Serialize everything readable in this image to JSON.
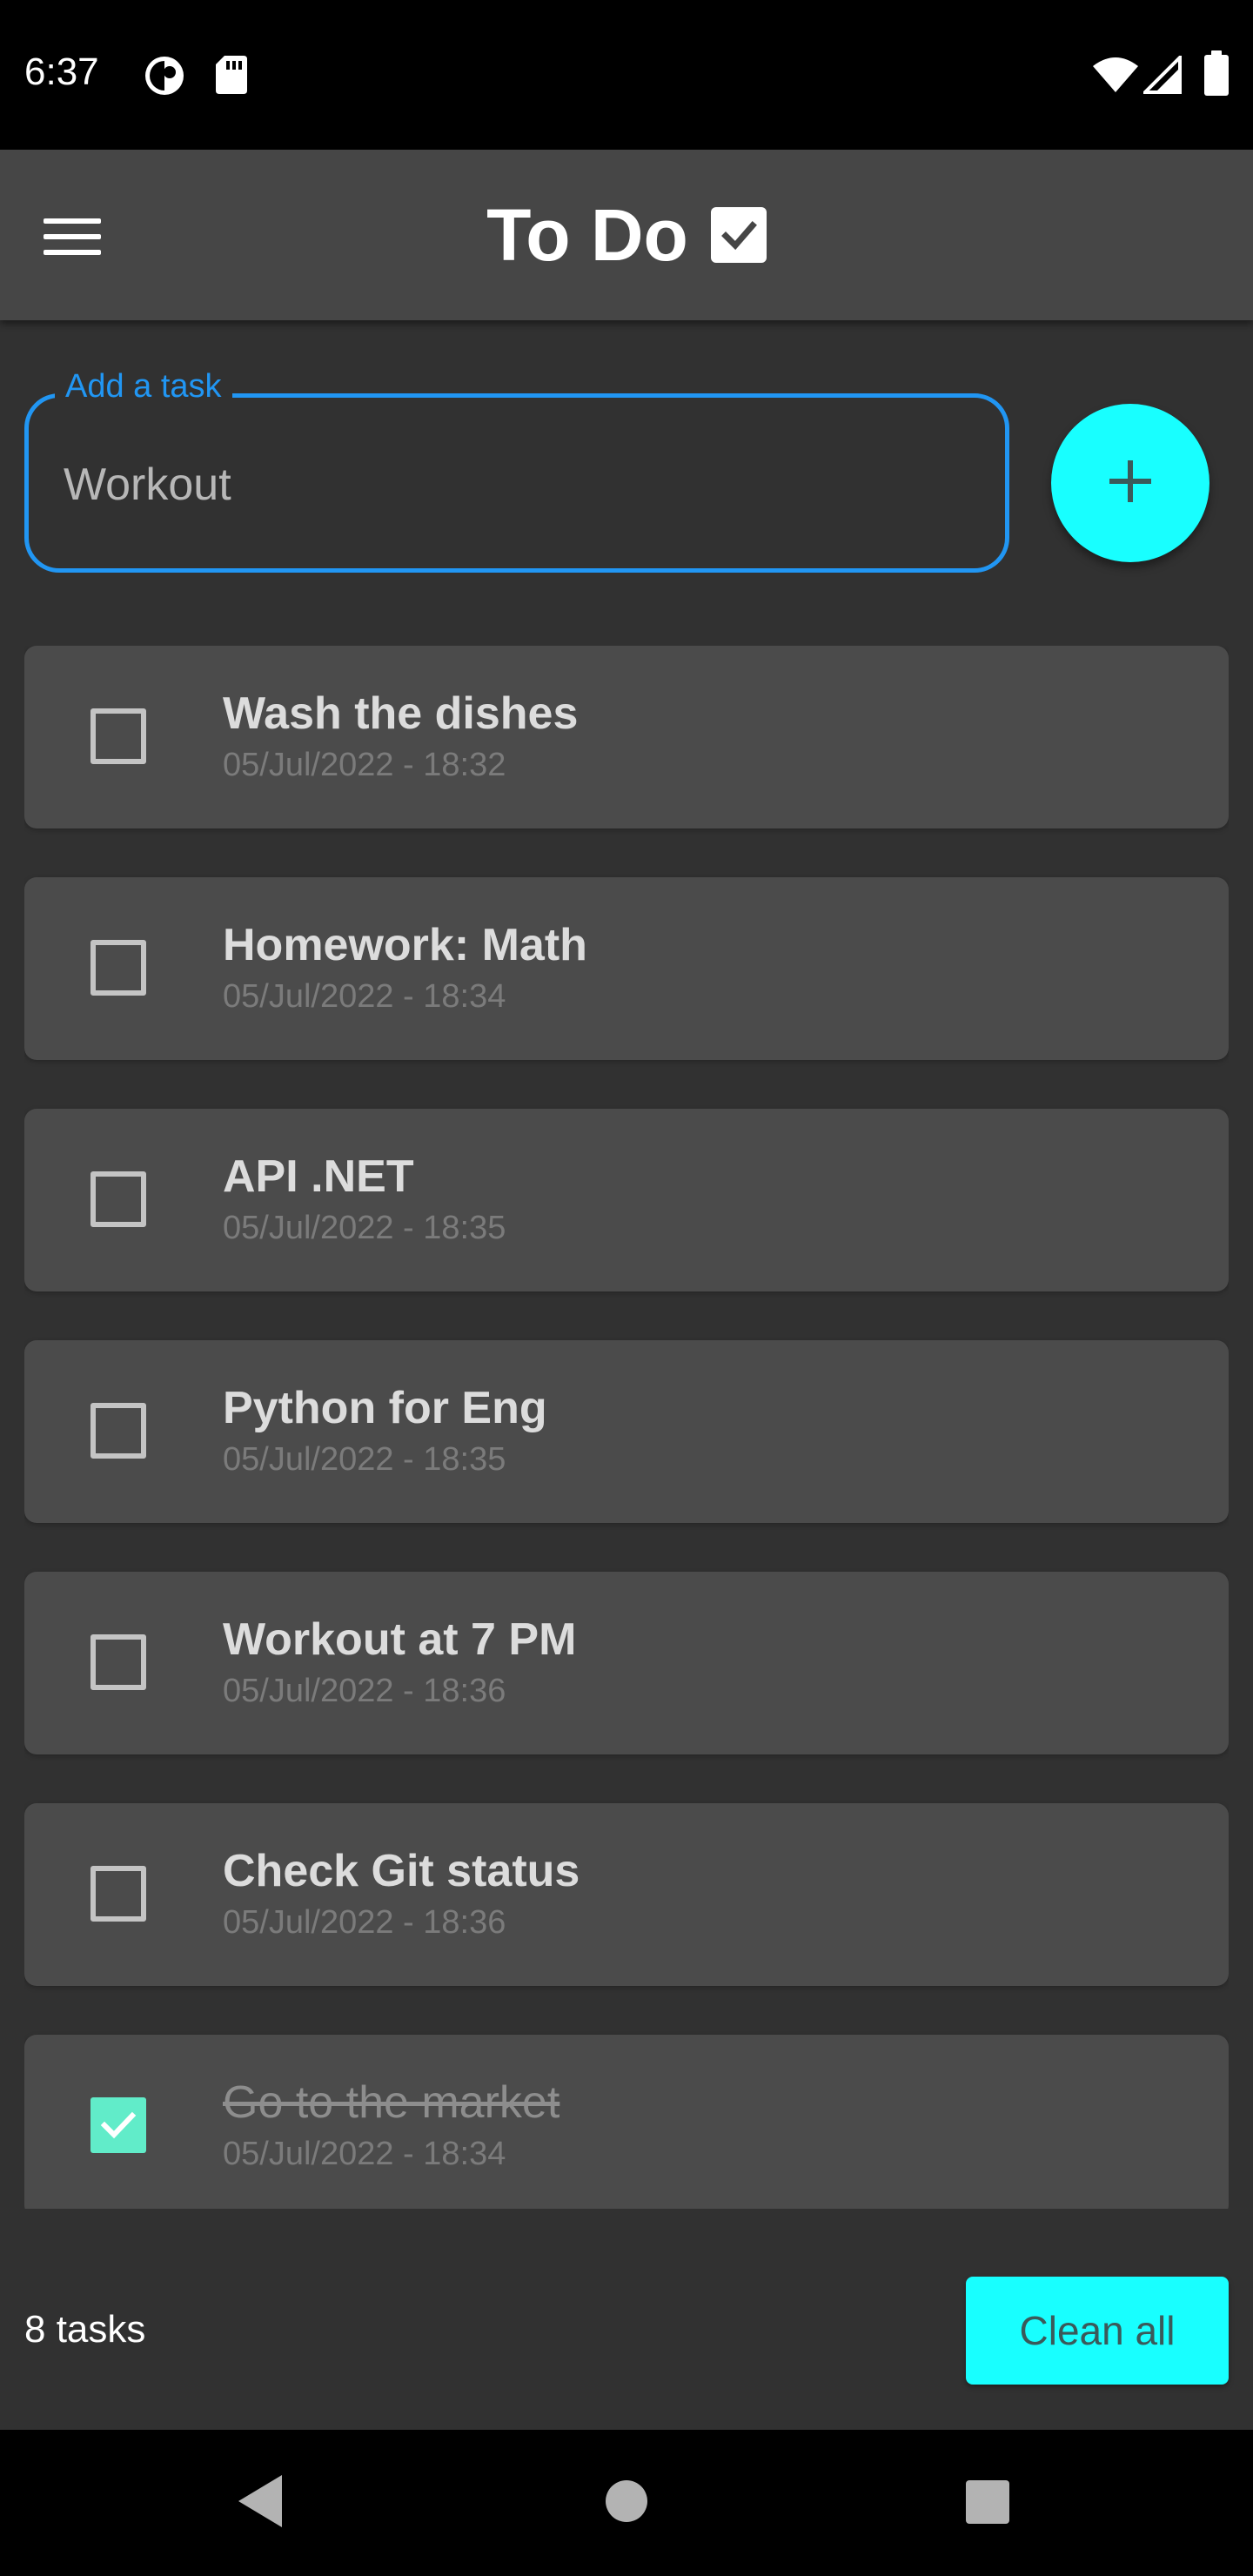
{
  "status_bar": {
    "time": "6:37",
    "left_icons": [
      "data-saver-icon",
      "sd-card-icon"
    ],
    "right_icons": [
      "wifi-icon",
      "cell-signal-icon",
      "battery-icon"
    ]
  },
  "app_bar": {
    "menu_icon": "menu-icon",
    "title": "To Do",
    "title_icon": "checkbox-checked-icon"
  },
  "add_task": {
    "label": "Add a task",
    "value": "Workout",
    "button_icon": "plus-icon"
  },
  "tasks": [
    {
      "title": "Wash the dishes",
      "timestamp": "05/Jul/2022 - 18:32",
      "done": false
    },
    {
      "title": "Homework: Math",
      "timestamp": "05/Jul/2022 - 18:34",
      "done": false
    },
    {
      "title": "API .NET",
      "timestamp": "05/Jul/2022 - 18:35",
      "done": false
    },
    {
      "title": "Python for Eng",
      "timestamp": "05/Jul/2022 - 18:35",
      "done": false
    },
    {
      "title": "Workout at 7 PM",
      "timestamp": "05/Jul/2022 - 18:36",
      "done": false
    },
    {
      "title": "Check Git status",
      "timestamp": "05/Jul/2022 - 18:36",
      "done": false
    },
    {
      "title": "Go to the market",
      "timestamp": "05/Jul/2022 - 18:34",
      "done": true
    }
  ],
  "footer": {
    "count": "8 tasks",
    "clean_label": "Clean all"
  },
  "colors": {
    "accent": "#18ffff",
    "focus": "#2196f3",
    "check_done": "#61ecc9",
    "background": "#313131",
    "card": "#4b4b4b",
    "app_bar": "#464646"
  },
  "nav_bar": {
    "icons": [
      "back-icon",
      "home-icon",
      "recents-icon"
    ]
  }
}
